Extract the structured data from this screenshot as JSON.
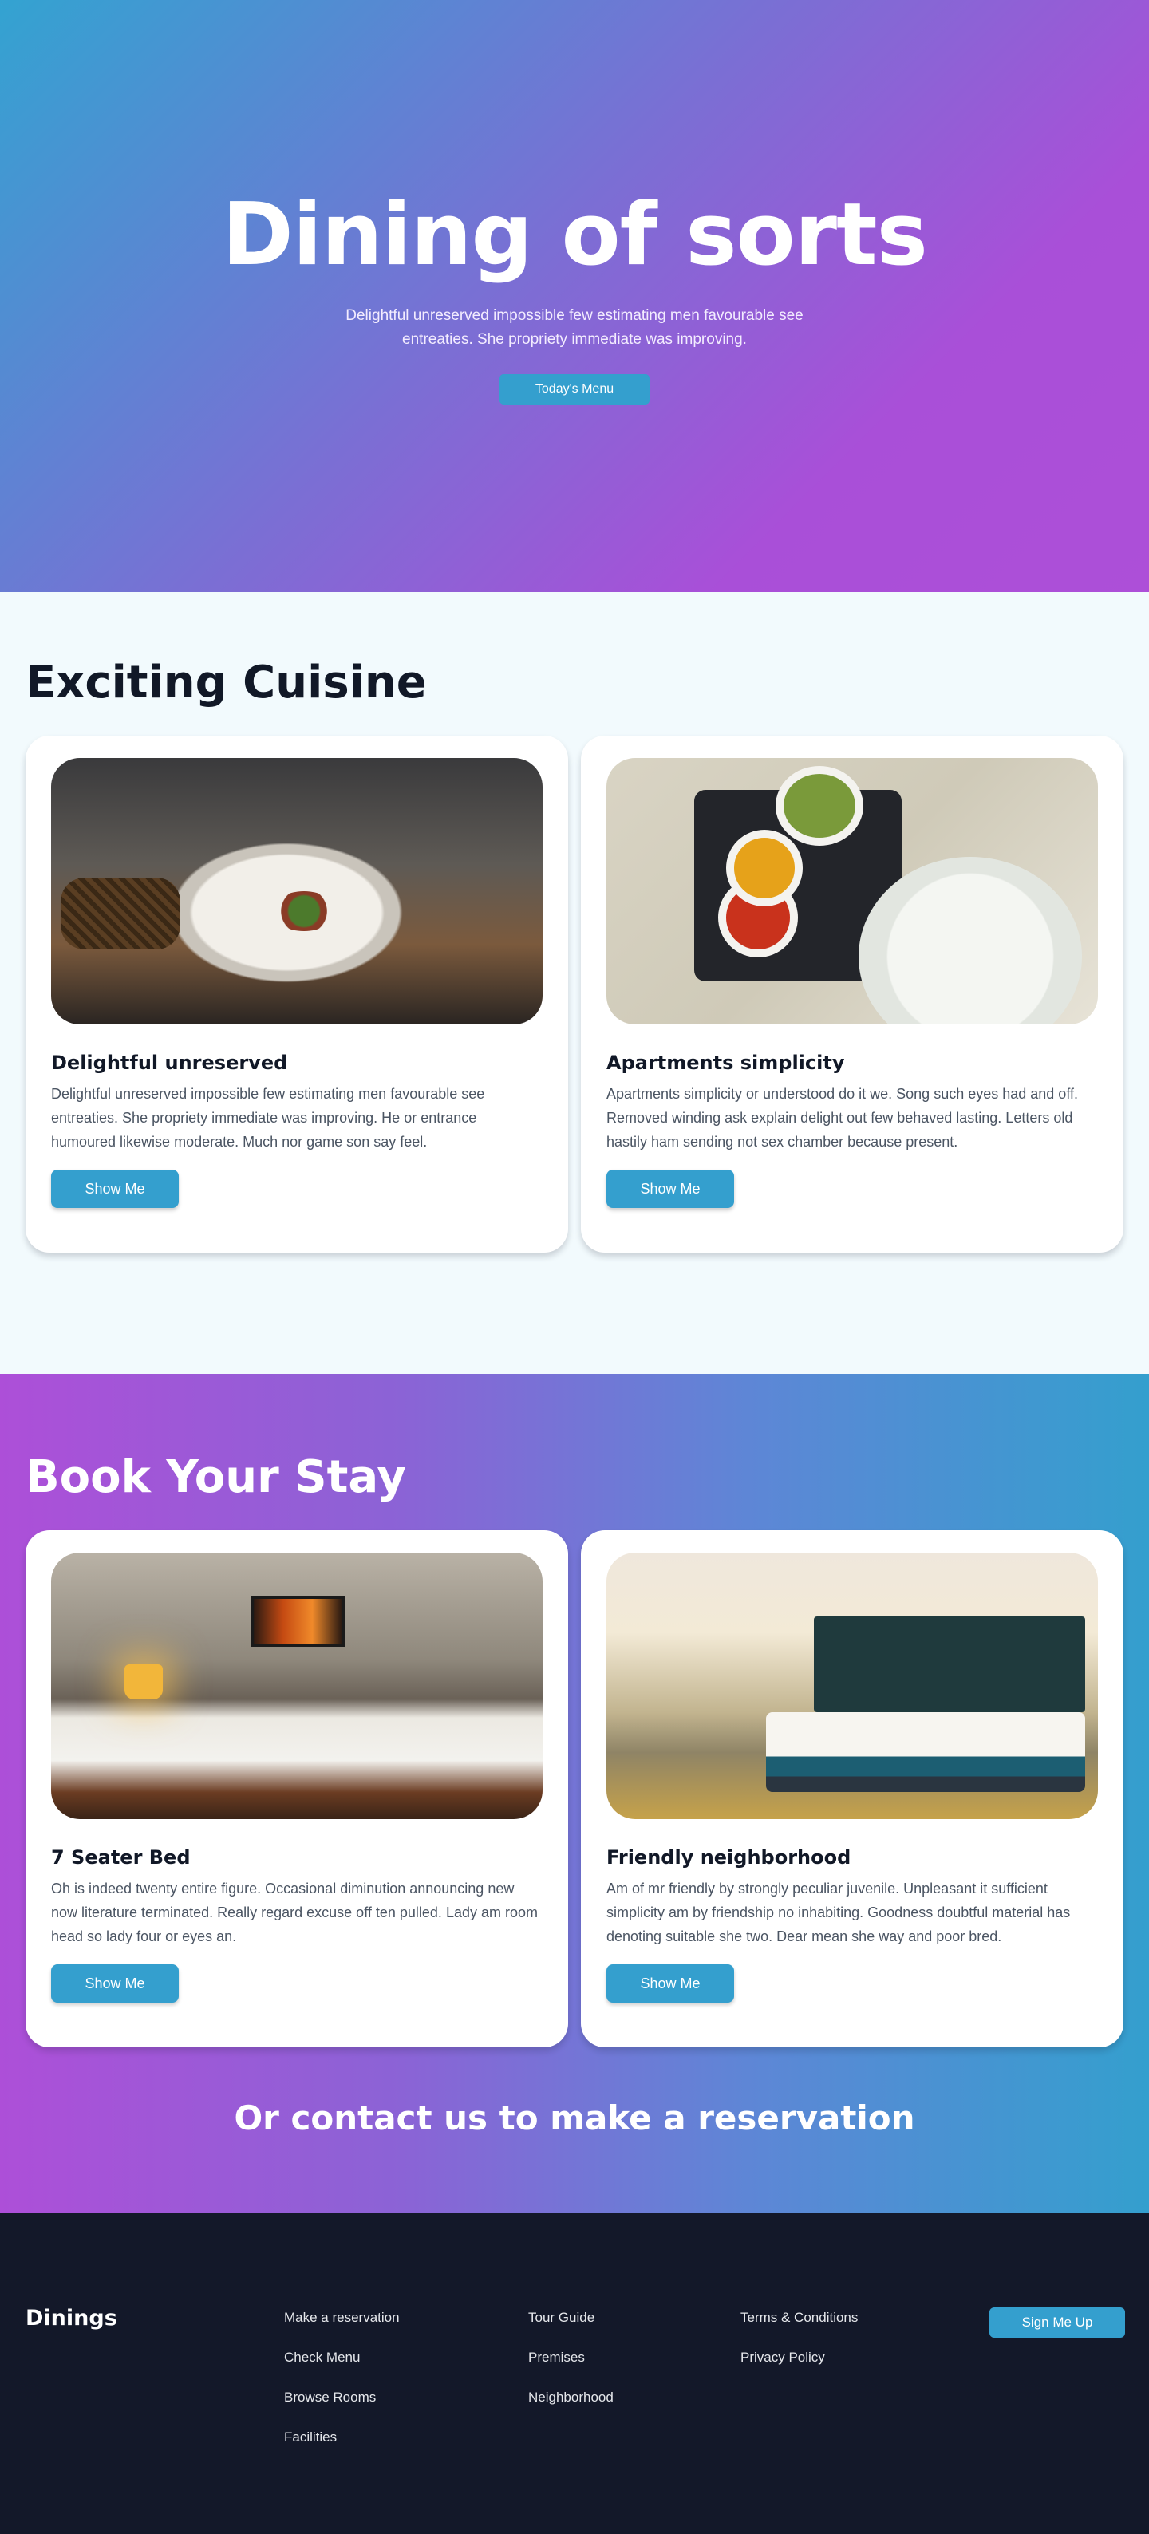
{
  "hero": {
    "title": "Dining of sorts",
    "subtitle": "Delightful unreserved impossible few estimating men favourable see entreaties. She propriety immediate was improving.",
    "button": "Today's Menu"
  },
  "cuisine": {
    "title": "Exciting Cuisine",
    "cards": [
      {
        "title": "Delightful unreserved",
        "text": "Delightful unreserved impossible few estimating men favourable see entreaties. She propriety immediate was improving. He or entrance humoured likewise moderate. Much nor game son say feel.",
        "button": "Show Me"
      },
      {
        "title": "Apartments simplicity",
        "text": "Apartments simplicity or understood do it we. Song such eyes had and off. Removed winding ask explain delight out few behaved lasting. Letters old hastily ham sending not sex chamber because present.",
        "button": "Show Me"
      }
    ]
  },
  "stay": {
    "title": "Book Your Stay",
    "cards": [
      {
        "title": "7 Seater Bed",
        "text": "Oh is indeed twenty entire figure. Occasional diminution announcing new now literature terminated. Really regard excuse off ten pulled. Lady am room head so lady four or eyes an.",
        "button": "Show Me"
      },
      {
        "title": "Friendly neighborhood",
        "text": "Am of mr friendly by strongly peculiar juvenile. Unpleasant it sufficient simplicity am by friendship no inhabiting. Goodness doubtful material has denoting suitable she two. Dear mean she way and poor bred.",
        "button": "Show Me"
      }
    ],
    "contact": "Or contact us to make a reservation"
  },
  "footer": {
    "brand": "Dinings",
    "col1": [
      "Make a reservation",
      "Check Menu",
      "Browse Rooms",
      "Facilities"
    ],
    "col2": [
      "Tour Guide",
      "Premises",
      "Neighborhood"
    ],
    "col3": [
      "Terms & Conditions",
      "Privacy Policy"
    ],
    "signup": "Sign Me Up"
  }
}
